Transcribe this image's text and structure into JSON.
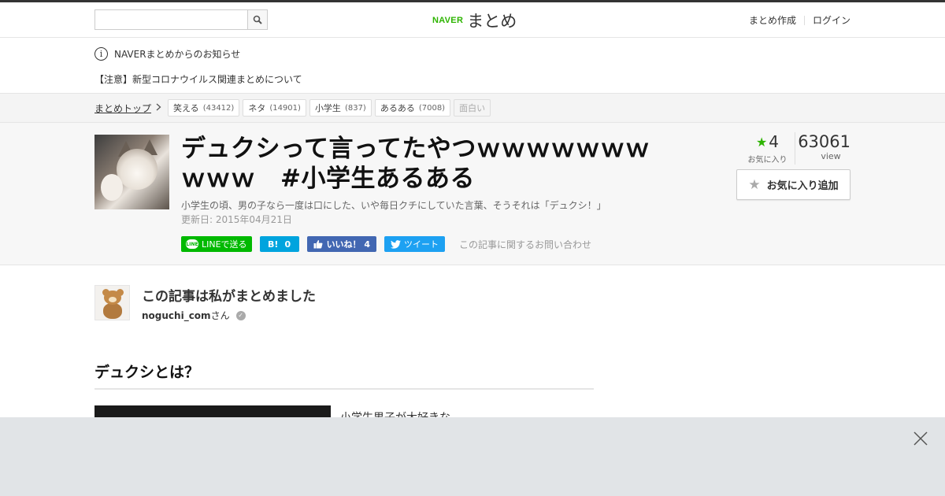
{
  "header": {
    "search": {
      "value": "",
      "placeholder": ""
    },
    "logo": {
      "naver": "NAVER",
      "matome": "まとめ"
    },
    "links": {
      "create": "まとめ作成",
      "login": "ログイン"
    }
  },
  "notice": {
    "title": "NAVERまとめからのお知らせ",
    "item": "【注意】新型コロナウイルス関連まとめについて"
  },
  "breadcrumb": {
    "top_label": "まとめトップ",
    "tags": [
      {
        "label": "笑える",
        "count": "(43412)"
      },
      {
        "label": "ネタ",
        "count": "(14901)"
      },
      {
        "label": "小学生",
        "count": "(837)"
      },
      {
        "label": "あるある",
        "count": "(7008)"
      },
      {
        "label": "面白い",
        "count": ""
      }
    ]
  },
  "article": {
    "title": "デュクシって言ってたやつｗｗｗｗｗｗｗｗｗｗ　#小学生あるある",
    "description": "小学生の頃、男の子なら一度は口にした、いや毎日クチにしていた言葉、そうそれは「デュクシ！」",
    "updated": "更新日: 2015年04月21日",
    "share": {
      "line": "LINEで送る",
      "hatena_count": "0",
      "fb": "いいね！ 4",
      "tweet": "ツイート",
      "inquiry": "この記事に関するお問い合わせ"
    },
    "stats": {
      "favorites": "4",
      "favorites_label": "お気に入り",
      "views": "63061",
      "views_label": "view"
    },
    "fav_button": "お気に入り追加"
  },
  "author": {
    "heading": "この記事は私がまとめました",
    "name": "noguchi_com",
    "suffix": "さん"
  },
  "section": {
    "heading": "デュクシとは？",
    "text": "小学生男子が大好きな"
  },
  "colors": {
    "naver_green": "#2db400",
    "line_green": "#00b900",
    "hatena_blue": "#00a4de",
    "facebook_blue": "#4267b2",
    "twitter_blue": "#1da1f2"
  }
}
